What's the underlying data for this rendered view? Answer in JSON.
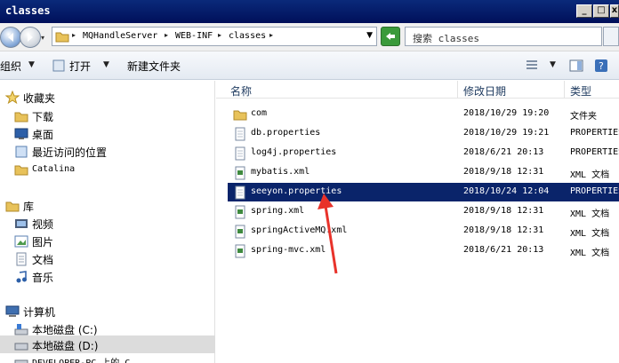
{
  "window": {
    "title": "classes",
    "min": "_",
    "max": "□",
    "close": "x"
  },
  "address": {
    "crumbs": [
      "MQHandleServer",
      "WEB-INF",
      "classes"
    ],
    "search_placeholder": "搜索 classes"
  },
  "toolbar": {
    "organize": "组织",
    "open": "打开",
    "new_folder": "新建文件夹"
  },
  "nav": {
    "favorites": "收藏夹",
    "fav_items": [
      "下载",
      "桌面",
      "最近访问的位置",
      "Catalina"
    ],
    "libraries": "库",
    "lib_items": [
      "视频",
      "图片",
      "文档",
      "音乐"
    ],
    "computer": "计算机",
    "drives": [
      "本地磁盘 (C:)",
      "本地磁盘 (D:)",
      "DEVELOPER-PC 上的 C"
    ]
  },
  "columns": {
    "name": "名称",
    "modified": "修改日期",
    "type": "类型"
  },
  "files": [
    {
      "name": "com",
      "date": "2018/10/29 19:20",
      "type": "文件夹",
      "icon": "folder-icon"
    },
    {
      "name": "db.properties",
      "date": "2018/10/29 19:21",
      "type": "PROPERTIES",
      "icon": "file-icon"
    },
    {
      "name": "log4j.properties",
      "date": "2018/6/21 20:13",
      "type": "PROPERTIES",
      "icon": "file-icon"
    },
    {
      "name": "mybatis.xml",
      "date": "2018/9/18 12:31",
      "type": "XML 文档",
      "icon": "xml-icon"
    },
    {
      "name": "seeyon.properties",
      "date": "2018/10/24 12:04",
      "type": "PROPERTIES",
      "icon": "file-icon",
      "selected": true
    },
    {
      "name": "spring.xml",
      "date": "2018/9/18 12:31",
      "type": "XML 文档",
      "icon": "xml-icon"
    },
    {
      "name": "springActiveMQ.xml",
      "date": "2018/9/18 12:31",
      "type": "XML 文档",
      "icon": "xml-icon"
    },
    {
      "name": "spring-mvc.xml",
      "date": "2018/6/21 20:13",
      "type": "XML 文档",
      "icon": "xml-icon"
    }
  ],
  "colors": {
    "selection": "#0a246a",
    "annotation_arrow": "#e8322a",
    "titlebar": "#0a2a7a"
  }
}
